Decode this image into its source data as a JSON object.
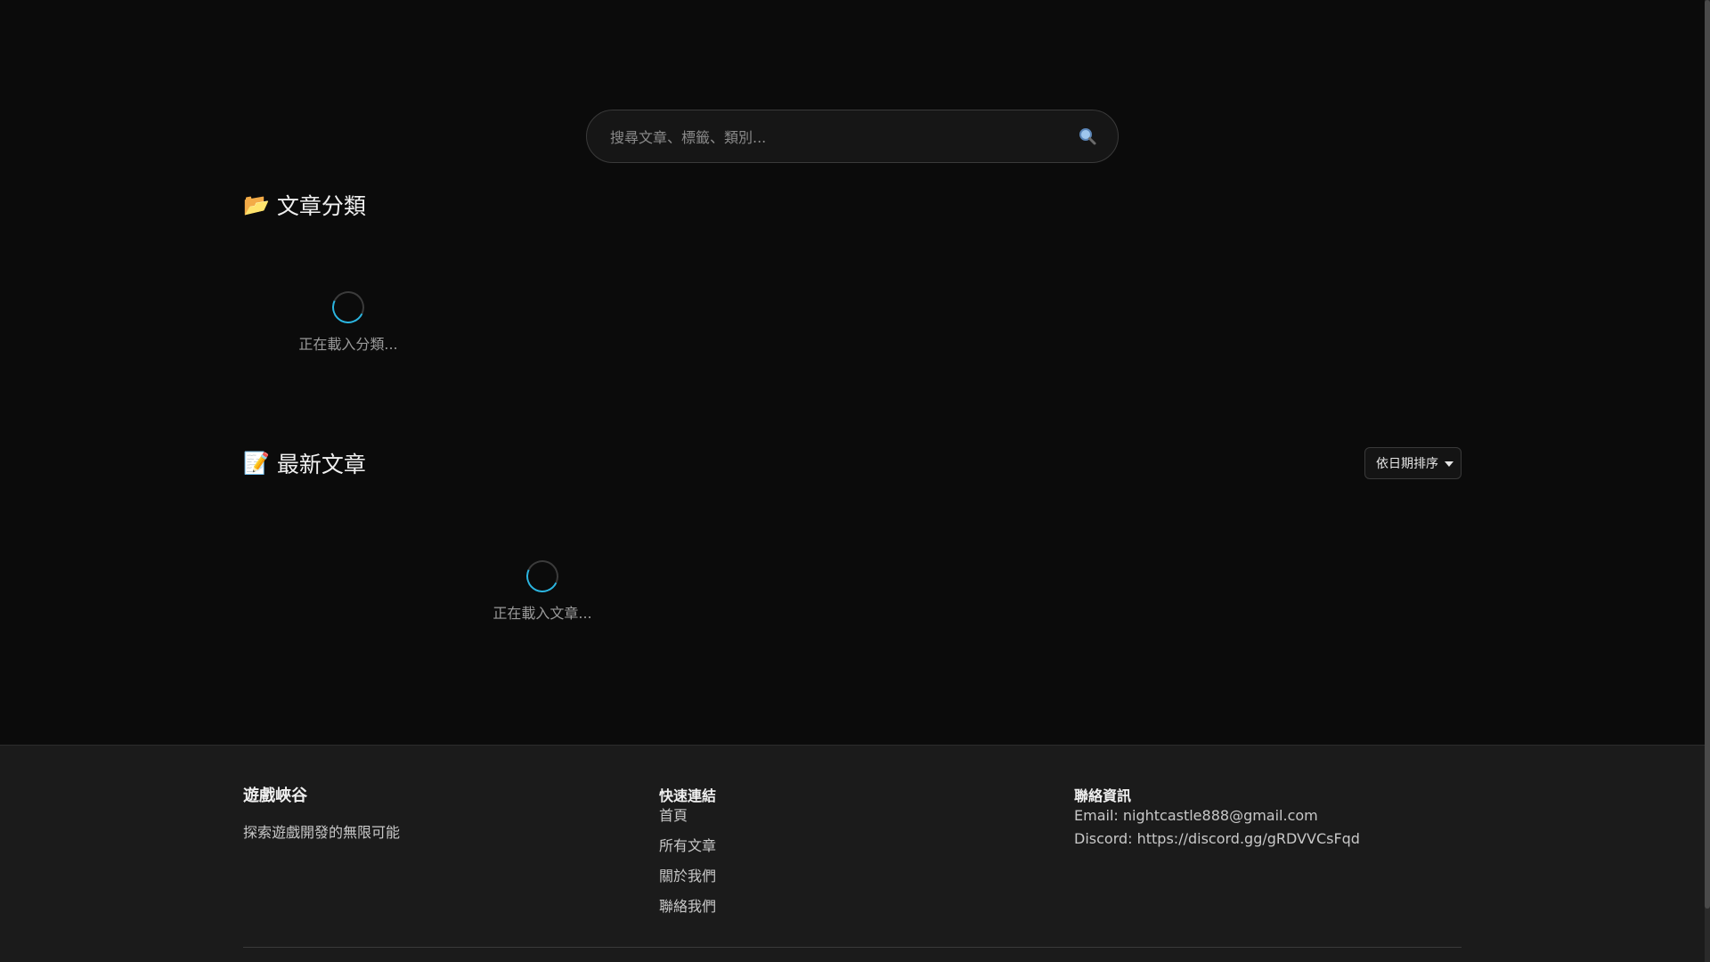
{
  "search": {
    "placeholder": "搜尋文章、標籤、類別...",
    "icon": "search-icon"
  },
  "categories": {
    "emoji": "📂",
    "title": "文章分類",
    "loading_text": "正在載入分類..."
  },
  "articles": {
    "emoji": "📝",
    "title": "最新文章",
    "sort_label": "依日期排序",
    "loading_text": "正在載入文章..."
  },
  "footer": {
    "brand": {
      "name": "遊戲峽谷",
      "tagline": "探索遊戲開發的無限可能"
    },
    "links": {
      "heading": "快速連結",
      "items": [
        "首頁",
        "所有文章",
        "關於我們",
        "聯絡我們"
      ]
    },
    "contact": {
      "heading": "聯絡資訊",
      "email": "Email: nightcastle888@gmail.com",
      "discord": "Discord: https://discord.gg/gRDVVCsFqd"
    }
  },
  "colors": {
    "background": "#0b0b0b",
    "footer_background": "#1b1b1b",
    "spinner_accent": "#2bb5e0"
  }
}
